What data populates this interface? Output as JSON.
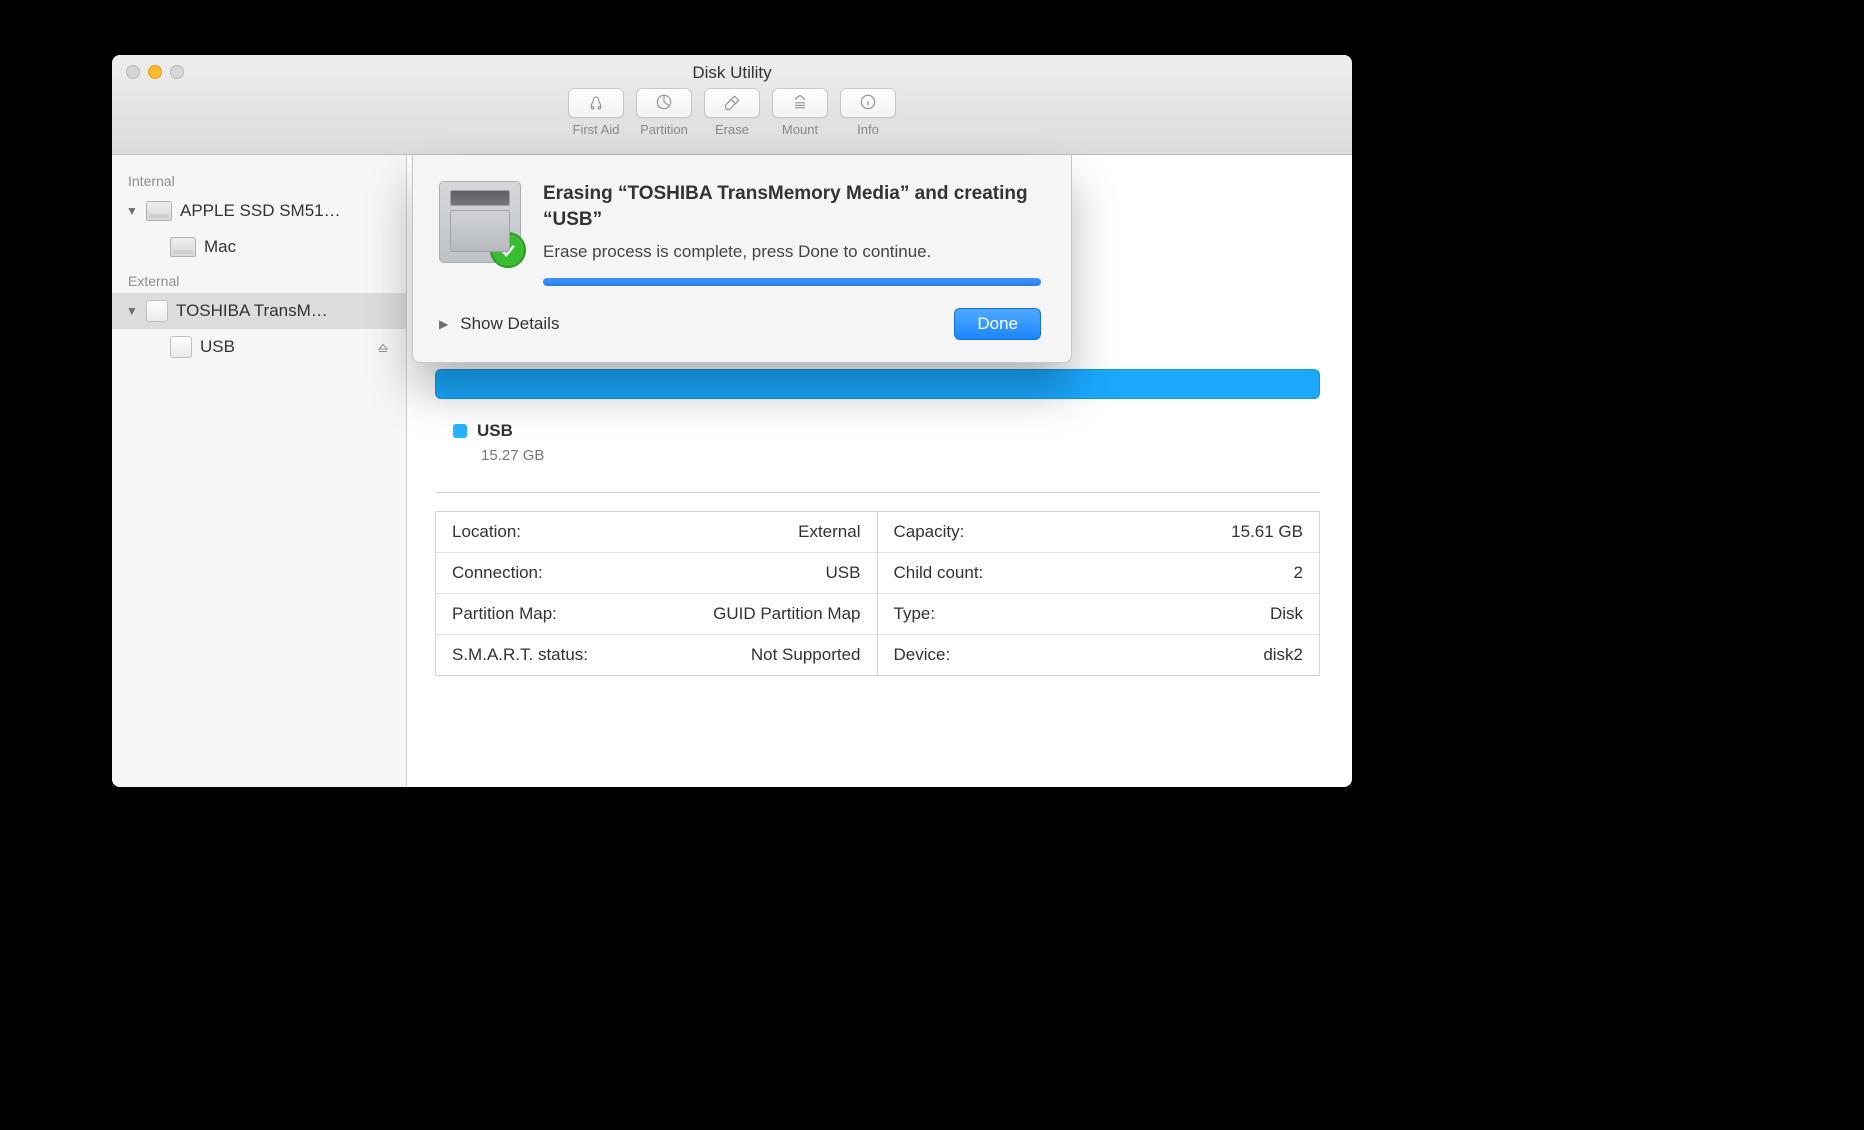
{
  "window": {
    "title": "Disk Utility"
  },
  "toolbar": [
    {
      "label": "First Aid"
    },
    {
      "label": "Partition"
    },
    {
      "label": "Erase"
    },
    {
      "label": "Mount"
    },
    {
      "label": "Info"
    }
  ],
  "sidebar": {
    "sections": [
      {
        "title": "Internal",
        "items": [
          {
            "label": "APPLE SSD SM51…",
            "children": [
              {
                "label": "Mac"
              }
            ]
          }
        ]
      },
      {
        "title": "External",
        "items": [
          {
            "label": "TOSHIBA TransM…",
            "selected": true,
            "children": [
              {
                "label": "USB",
                "ejectable": true
              }
            ]
          }
        ]
      }
    ]
  },
  "volume": {
    "name": "USB",
    "size": "15.27 GB"
  },
  "info": {
    "left": [
      {
        "k": "Location:",
        "v": "External"
      },
      {
        "k": "Connection:",
        "v": "USB"
      },
      {
        "k": "Partition Map:",
        "v": "GUID Partition Map"
      },
      {
        "k": "S.M.A.R.T. status:",
        "v": "Not Supported"
      }
    ],
    "right": [
      {
        "k": "Capacity:",
        "v": "15.61 GB"
      },
      {
        "k": "Child count:",
        "v": "2"
      },
      {
        "k": "Type:",
        "v": "Disk"
      },
      {
        "k": "Device:",
        "v": "disk2"
      }
    ]
  },
  "sheet": {
    "title": "Erasing “TOSHIBA TransMemory Media” and creating “USB”",
    "subtitle": "Erase process is complete, press Done to continue.",
    "details_label": "Show Details",
    "done_label": "Done"
  }
}
